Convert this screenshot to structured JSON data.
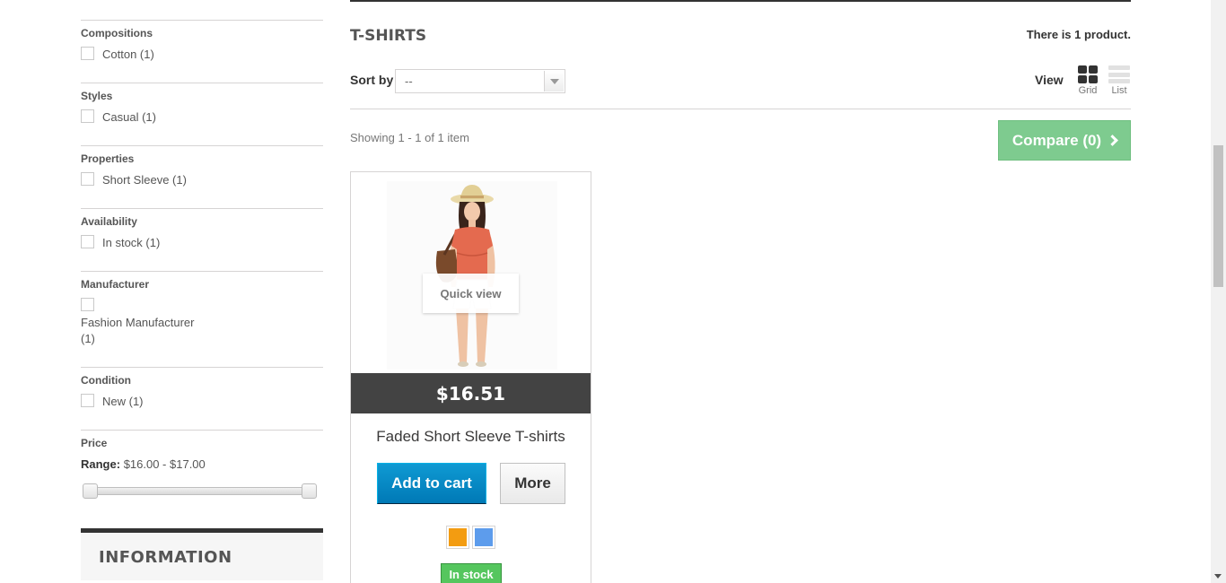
{
  "sidebar": {
    "filters": [
      {
        "title": "Compositions",
        "options": [
          {
            "label": "Cotton (1)"
          }
        ]
      },
      {
        "title": "Styles",
        "options": [
          {
            "label": "Casual (1)"
          }
        ]
      },
      {
        "title": "Properties",
        "options": [
          {
            "label": "Short Sleeve (1)"
          }
        ]
      },
      {
        "title": "Availability",
        "options": [
          {
            "label": "In stock (1)"
          }
        ]
      },
      {
        "title": "Manufacturer",
        "options": [
          {
            "label_line1": "Fashion Manufacturer",
            "label_line2": "(1)"
          }
        ]
      },
      {
        "title": "Condition",
        "options": [
          {
            "label": "New (1)"
          }
        ]
      }
    ],
    "price": {
      "title": "Price",
      "range_label": "Range:",
      "range_value": "$16.00 - $17.00"
    },
    "information": {
      "title": "INFORMATION"
    }
  },
  "main": {
    "category_title": "T-SHIRTS",
    "product_count": "There is 1 product.",
    "sort": {
      "label": "Sort by",
      "selected": "--"
    },
    "view": {
      "label": "View",
      "grid_label": "Grid",
      "list_label": "List",
      "active": "grid"
    },
    "showing": "Showing 1 - 1 of 1 item",
    "compare_label": "Compare (0)"
  },
  "product": {
    "name": "Faded Short Sleeve T-shirts",
    "price": "$16.51",
    "quick_view": "Quick view",
    "add_to_cart": "Add to cart",
    "more": "More",
    "availability": "In stock",
    "colors": [
      "#f39c11",
      "#5d9cec"
    ]
  },
  "icons": {
    "grid_view": "grid-view-icon",
    "list_view": "list-view-icon",
    "compare_chevron": "chevron-right-icon",
    "sort_dropdown": "chevron-down-icon"
  }
}
